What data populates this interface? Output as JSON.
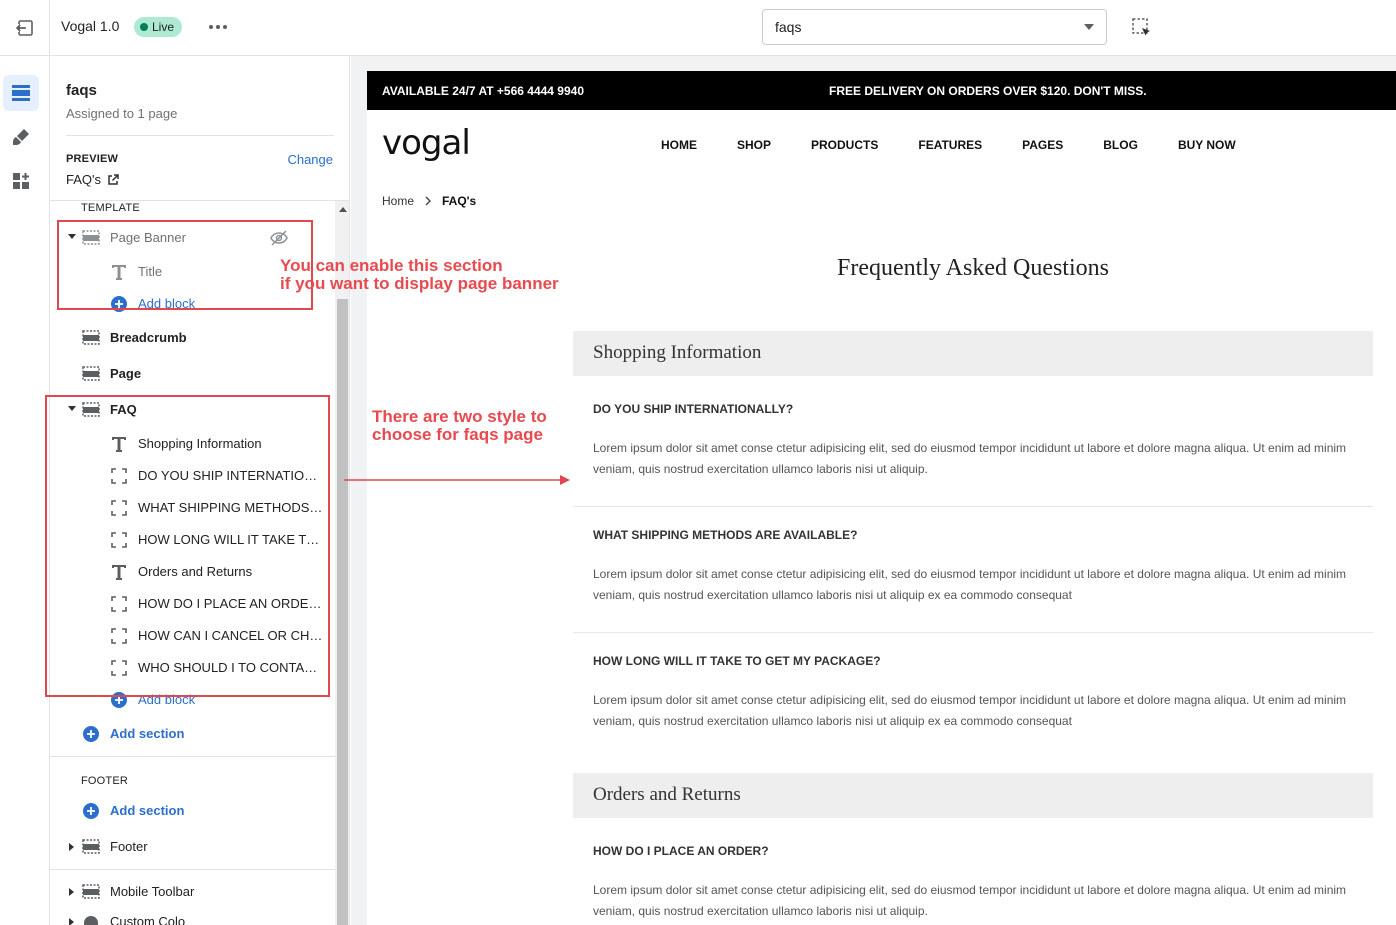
{
  "topbar": {
    "theme_name": "Vogal 1.0",
    "live_badge": "Live",
    "template_select_value": "faqs"
  },
  "sidebar": {
    "title": "faqs",
    "subtitle": "Assigned to 1 page",
    "preview_label": "PREVIEW",
    "change_label": "Change",
    "preview_value": "FAQ's",
    "template_label": "TEMPLATE",
    "footer_label": "FOOTER",
    "page_banner": {
      "label": "Page Banner",
      "blocks": [
        {
          "label": "Title"
        }
      ],
      "add_block": "Add block"
    },
    "breadcrumb_label": "Breadcrumb",
    "page_label": "Page",
    "faq": {
      "label": "FAQ",
      "blocks": [
        {
          "label": "Shopping Information",
          "icon": "text-icon"
        },
        {
          "label": "DO YOU SHIP INTERNATIONALLY?",
          "icon": "block-icon"
        },
        {
          "label": "WHAT SHIPPING METHODS ARE AVAILABLE?",
          "icon": "block-icon"
        },
        {
          "label": "HOW LONG WILL IT TAKE TO GET MY PACKAGE?",
          "icon": "block-icon"
        },
        {
          "label": "Orders and Returns",
          "icon": "text-icon"
        },
        {
          "label": "HOW DO I PLACE AN ORDER?",
          "icon": "block-icon"
        },
        {
          "label": "HOW CAN I CANCEL OR CHANGE MY ORDER?",
          "icon": "block-icon"
        },
        {
          "label": "WHO SHOULD I TO CONTACT?",
          "icon": "block-icon"
        }
      ],
      "add_block": "Add block"
    },
    "add_section_template": "Add section",
    "add_section_footer": "Add section",
    "footer_section": "Footer",
    "mobile_toolbar": "Mobile Toolbar",
    "custom_colors_partial": "Custom Colo"
  },
  "store": {
    "announce_left": "AVAILABLE 24/7 AT +566 4444 9940",
    "announce_center": "FREE DELIVERY ON ORDERS OVER $120. DON'T MISS.",
    "logo": "vogal",
    "nav": [
      "HOME",
      "SHOP",
      "PRODUCTS",
      "FEATURES",
      "PAGES",
      "BLOG",
      "BUY NOW"
    ],
    "breadcrumb_home": "Home",
    "breadcrumb_current": "FAQ's",
    "page_heading": "Frequently Asked Questions",
    "categories": [
      {
        "title": "Shopping Information",
        "items": [
          {
            "q": "DO YOU SHIP INTERNATIONALLY?",
            "a": "Lorem ipsum dolor sit amet conse ctetur adipisicing elit, sed do eiusmod tempor incididunt ut labore et dolore magna aliqua. Ut enim ad minim veniam, quis nostrud exercitation ullamco laboris nisi ut aliquip."
          },
          {
            "q": "WHAT SHIPPING METHODS ARE AVAILABLE?",
            "a": "Lorem ipsum dolor sit amet conse ctetur adipisicing elit, sed do eiusmod tempor incididunt ut labore et dolore magna aliqua. Ut enim ad minim veniam, quis nostrud exercitation ullamco laboris nisi ut aliquip ex ea commodo consequat"
          },
          {
            "q": "HOW LONG WILL IT TAKE TO GET MY PACKAGE?",
            "a": "Lorem ipsum dolor sit amet conse ctetur adipisicing elit, sed do eiusmod tempor incididunt ut labore et dolore magna aliqua. Ut enim ad minim veniam, quis nostrud exercitation ullamco laboris nisi ut aliquip ex ea commodo consequat"
          }
        ]
      },
      {
        "title": "Orders and Returns",
        "items": [
          {
            "q": "HOW DO I PLACE AN ORDER?",
            "a": "Lorem ipsum dolor sit amet conse ctetur adipisicing elit, sed do eiusmod tempor incididunt ut labore et dolore magna aliqua. Ut enim ad minim veniam, quis nostrud exercitation ullamco laboris nisi ut aliquip."
          }
        ]
      }
    ]
  },
  "annotations": {
    "banner_note": "You can enable this section\nif you want to display page banner",
    "faq_note": "There are two style to\nchoose for faqs page"
  },
  "colors": {
    "accent": "#2c6ecb",
    "annotation": "#e84a4f",
    "live_badge_bg": "#aee9d1"
  }
}
